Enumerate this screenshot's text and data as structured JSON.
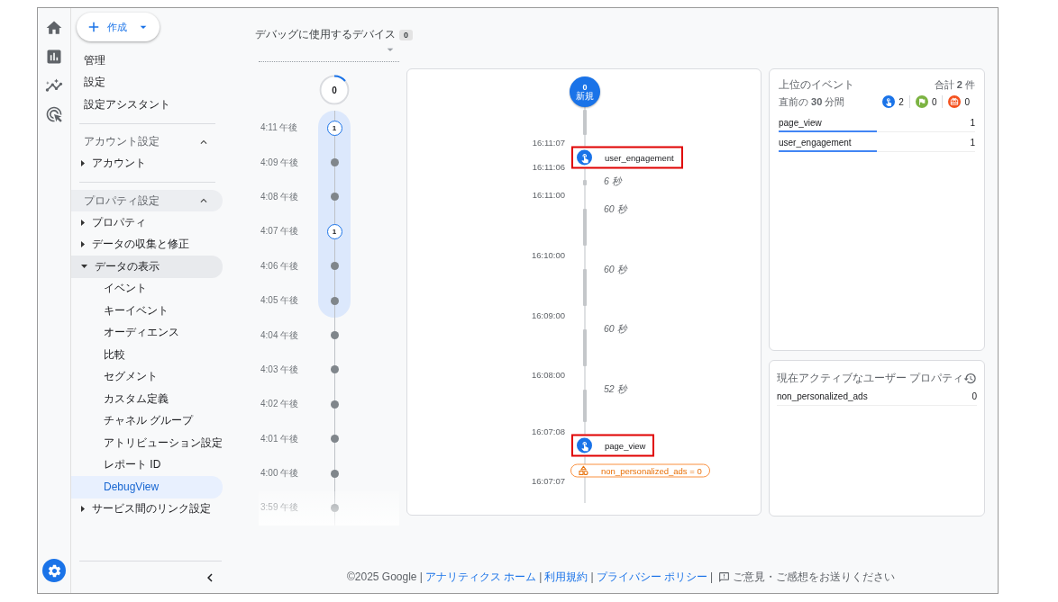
{
  "sidebar": {
    "create_button": "作成",
    "top_items": [
      "管理",
      "設定",
      "設定アシスタント"
    ],
    "sections": [
      {
        "title": "アカウント設定",
        "expanded": true,
        "hovered": false,
        "items": [
          {
            "label": "アカウント",
            "expanded": false
          }
        ]
      },
      {
        "title": "プロパティ設定",
        "expanded": true,
        "hovered": true,
        "items": [
          {
            "label": "プロパティ",
            "expanded": false
          },
          {
            "label": "データの収集と修正",
            "expanded": false
          },
          {
            "label": "データの表示",
            "expanded": true,
            "children": [
              {
                "label": "イベント",
                "selected": false
              },
              {
                "label": "キーイベント",
                "selected": false
              },
              {
                "label": "オーディエンス",
                "selected": false
              },
              {
                "label": "比較",
                "selected": false
              },
              {
                "label": "セグメント",
                "selected": false
              },
              {
                "label": "カスタム定義",
                "selected": false
              },
              {
                "label": "チャネル グループ",
                "selected": false
              },
              {
                "label": "アトリビューション設定",
                "selected": false
              },
              {
                "label": "レポート ID",
                "selected": false
              },
              {
                "label": "DebugView",
                "selected": true
              }
            ]
          },
          {
            "label": "サービス間のリンク設定",
            "expanded": false
          }
        ]
      }
    ]
  },
  "devices": {
    "label": "デバッグに使用するデバイス",
    "count": "0"
  },
  "minutes": {
    "total": "0",
    "rows": [
      {
        "time": "4:11 午後",
        "count": "1",
        "in_window": true
      },
      {
        "time": "4:09 午後",
        "in_window": true
      },
      {
        "time": "4:08 午後",
        "in_window": true
      },
      {
        "time": "4:07 午後",
        "count": "1",
        "in_window": true
      },
      {
        "time": "4:06 午後",
        "in_window": true
      },
      {
        "time": "4:05 午後",
        "in_window": true
      },
      {
        "time": "4:04 午後",
        "in_window": false
      },
      {
        "time": "4:03 午後",
        "in_window": false
      },
      {
        "time": "4:02 午後",
        "in_window": false
      },
      {
        "time": "4:01 午後",
        "in_window": false
      },
      {
        "time": "4:00 午後",
        "in_window": false
      },
      {
        "time": "3:59 午後",
        "in_window": false
      }
    ]
  },
  "stream": {
    "count": "0",
    "label": "新規",
    "items": [
      {
        "kind": "time",
        "text": "16:11:07"
      },
      {
        "kind": "event",
        "name": "user_engagement",
        "highlighted": true
      },
      {
        "kind": "time",
        "text": "16:11:06"
      },
      {
        "kind": "gap",
        "text": "6 秒"
      },
      {
        "kind": "time",
        "text": "16:11:00"
      },
      {
        "kind": "gap",
        "text": "60 秒"
      },
      {
        "kind": "time",
        "text": "16:10:00"
      },
      {
        "kind": "gap",
        "text": "60 秒"
      },
      {
        "kind": "time",
        "text": "16:09:00"
      },
      {
        "kind": "gap",
        "text": "60 秒"
      },
      {
        "kind": "time",
        "text": "16:08:00"
      },
      {
        "kind": "gap",
        "text": "52 秒"
      },
      {
        "kind": "time",
        "text": "16:07:08"
      },
      {
        "kind": "event",
        "name": "page_view",
        "highlighted": true
      },
      {
        "kind": "property",
        "text": "non_personalized_ads = 0"
      },
      {
        "kind": "time",
        "text": "16:07:07"
      }
    ]
  },
  "top_events": {
    "title": "上位のイベント",
    "total": "合計 **2** 件",
    "period": "直前の **30** 分間",
    "counts": [
      {
        "kind": "event",
        "value": "2"
      },
      {
        "kind": "key_event",
        "value": "0"
      },
      {
        "kind": "error",
        "value": "0"
      }
    ],
    "rows": [
      {
        "name": "page_view",
        "count": "1"
      },
      {
        "name": "user_engagement",
        "count": "1"
      }
    ]
  },
  "user_properties": {
    "title": "現在アクティブなユーザー プロパティ",
    "rows": [
      {
        "name": "non_personalized_ads",
        "value": "0"
      }
    ]
  },
  "footer": [
    {
      "kind": "text",
      "text": "©2025 Google |"
    },
    {
      "kind": "link",
      "text": "アナリティクス ホーム"
    },
    {
      "kind": "text",
      "text": "|"
    },
    {
      "kind": "link",
      "text": "利用規約"
    },
    {
      "kind": "text",
      "text": "|"
    },
    {
      "kind": "link",
      "text": "プライバシー ポリシー"
    },
    {
      "kind": "text",
      "text": "|"
    },
    {
      "kind": "feedback",
      "text": "ご意見・ご感想をお送りください"
    }
  ]
}
